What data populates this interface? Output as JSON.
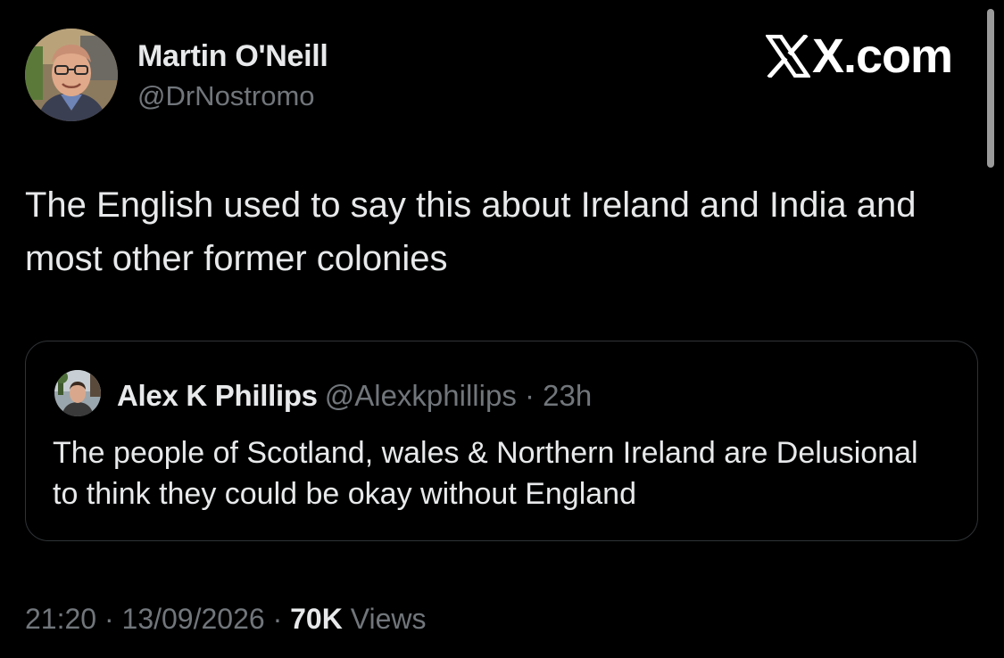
{
  "tweet": {
    "author": {
      "name": "Martin O'Neill",
      "handle": "@DrNostromo"
    },
    "brand": "X.com",
    "text": "The English used to say this about Ireland and India and most other former colonies",
    "quoted": {
      "author_name": "Alex K Phillips",
      "meta": "@Alexkphillips · 23h",
      "text": "The people of Scotland, wales & Northern Ireland are Delusional to think they could be okay without England"
    },
    "footer": {
      "time_date": "21:20 · 13/09/2026 · ",
      "views_count": "70K",
      "views_label": "Views"
    }
  },
  "colors": {
    "background": "#000000",
    "text_primary": "#e7e9ea",
    "text_secondary": "#71767b",
    "border": "#2f3336"
  }
}
